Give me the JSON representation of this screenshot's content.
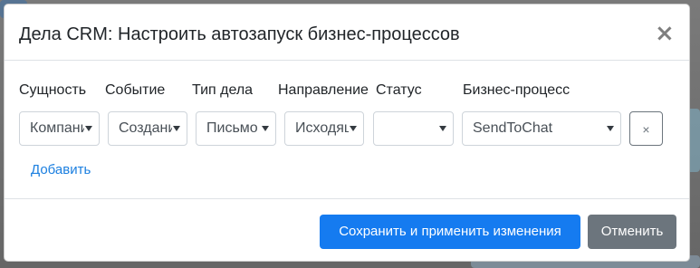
{
  "modal": {
    "title": "Дела CRM: Настроить автозапуск бизнес-процессов",
    "close_label": "×"
  },
  "columns": [
    {
      "label": "Сущность"
    },
    {
      "label": "Событие"
    },
    {
      "label": "Тип дела"
    },
    {
      "label": "Направление"
    },
    {
      "label": "Статус"
    },
    {
      "label": "Бизнес-процесс"
    }
  ],
  "rule_row": {
    "entity": "Компания",
    "event": "Создание",
    "activity_type": "Письмо",
    "direction": "Исходящее",
    "status": "",
    "business_process": "SendToChat",
    "remove_label": "×"
  },
  "add_link": "Добавить",
  "footer": {
    "save_label": "Сохранить и применить изменения",
    "cancel_label": "Отменить"
  },
  "colors": {
    "primary": "#157bf0",
    "secondary": "#6c757d",
    "link": "#1b7fe0"
  }
}
